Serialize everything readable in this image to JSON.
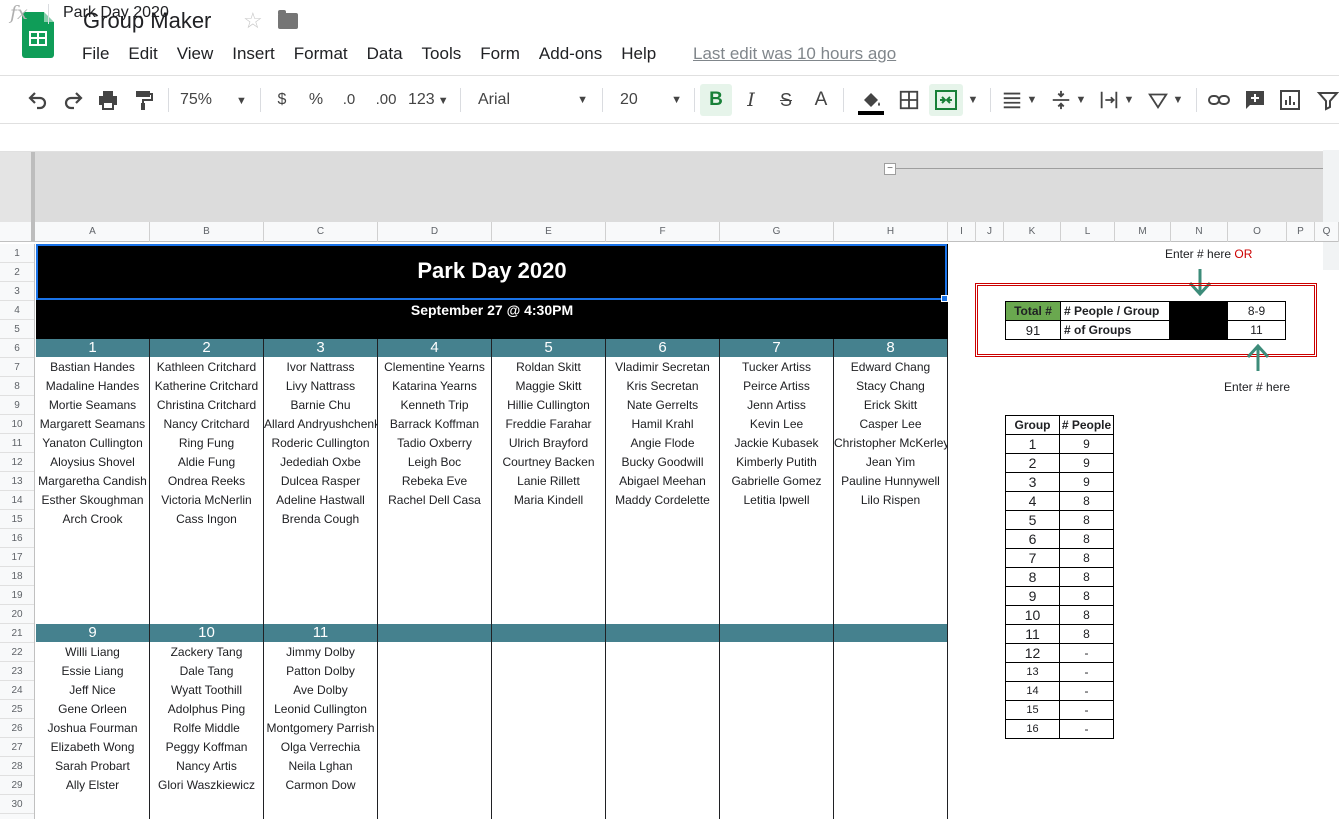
{
  "app": {
    "title": "Group Maker",
    "menu": [
      "File",
      "Edit",
      "View",
      "Insert",
      "Format",
      "Data",
      "Tools",
      "Form",
      "Add-ons",
      "Help"
    ],
    "last_edit": "Last edit was 10 hours ago"
  },
  "toolbar": {
    "zoom": "75%",
    "currency": "$",
    "percent": "%",
    "decrease_decimals": ".0",
    "increase_decimals": ".00",
    "number_format": "123",
    "font": "Arial",
    "font_size": "20",
    "bold": "B",
    "italic": "I",
    "strike": "S",
    "text_color": "A",
    "icons": [
      "undo-icon",
      "redo-icon",
      "print-icon",
      "paint-format-icon",
      "fill-color-icon",
      "borders-icon",
      "merge-cells-icon",
      "align-icon",
      "valign-icon",
      "text-rotate-icon",
      "link-icon",
      "comment-icon",
      "chart-icon",
      "filter-icon"
    ]
  },
  "formula_bar": {
    "fx": "fx",
    "value": "Park Day 2020"
  },
  "columns": [
    "A",
    "B",
    "C",
    "D",
    "E",
    "F",
    "G",
    "H",
    "I",
    "J",
    "K",
    "L",
    "M",
    "N",
    "O",
    "P",
    "Q"
  ],
  "rows": [
    "1",
    "2",
    "3",
    "4",
    "5",
    "6",
    "7",
    "8",
    "9",
    "10",
    "11",
    "12",
    "13",
    "14",
    "15",
    "16",
    "17",
    "18",
    "19",
    "20",
    "21",
    "22",
    "23",
    "24",
    "25",
    "26",
    "27",
    "28",
    "29",
    "30"
  ],
  "sheet": {
    "title": "Park Day 2020",
    "subtitle": "September 27 @ 4:30PM",
    "groups_row1": [
      {
        "num": "1",
        "members": [
          "Bastian Handes",
          "Madaline Handes",
          "Mortie Seamans",
          "Margarett Seamans",
          "Yanaton Cullington",
          "Aloysius Shovel",
          "Margaretha Candish",
          "Esther Skoughman",
          "Arch Crook"
        ]
      },
      {
        "num": "2",
        "members": [
          "Kathleen Critchard",
          "Katherine Critchard",
          "Christina Critchard",
          "Nancy Critchard",
          "Ring Fung",
          "Aldie Fung",
          "Ondrea Reeks",
          "Victoria McNerlin",
          "Cass Ingon"
        ]
      },
      {
        "num": "3",
        "members": [
          "Ivor Nattrass",
          "Livy Nattrass",
          "Barnie Chu",
          "Allard Andryushchenko",
          "Roderic Cullington",
          "Jedediah Oxbe",
          "Dulcea Rasper",
          "Adeline Hastwall",
          "Brenda Cough"
        ]
      },
      {
        "num": "4",
        "members": [
          "Clementine Yearns",
          "Katarina Yearns",
          "Kenneth Trip",
          "Barrack Koffman",
          "Tadio Oxberry",
          "Leigh Boc",
          "Rebeka Eve",
          "Rachel Dell Casa"
        ]
      },
      {
        "num": "5",
        "members": [
          "Roldan Skitt",
          "Maggie Skitt",
          "Hillie Cullington",
          "Freddie Farahar",
          "Ulrich Brayford",
          "Courtney Backen",
          "Lanie Rillett",
          "Maria Kindell"
        ]
      },
      {
        "num": "6",
        "members": [
          "Vladimir Secretan",
          "Kris Secretan",
          "Nate Gerrelts",
          "Hamil Krahl",
          "Angie Flode",
          "Bucky Goodwill",
          "Abigael Meehan",
          "Maddy Cordelette"
        ]
      },
      {
        "num": "7",
        "members": [
          "Tucker Artiss",
          "Peirce Artiss",
          "Jenn Artiss",
          "Kevin Lee",
          "Jackie Kubasek",
          "Kimberly Putith",
          "Gabrielle Gomez",
          "Letitia Ipwell"
        ]
      },
      {
        "num": "8",
        "members": [
          "Edward Chang",
          "Stacy Chang",
          "Erick Skitt",
          "Casper Lee",
          "Christopher McKerley",
          "Jean Yim",
          "Pauline Hunnywell",
          "Lilo Rispen"
        ]
      }
    ],
    "groups_row2": [
      {
        "num": "9",
        "members": [
          "Willi Liang",
          "Essie Liang",
          "Jeff Nice",
          "Gene Orleen",
          "Joshua Fourman",
          "Elizabeth Wong",
          "Sarah Probart",
          "Ally Elster"
        ]
      },
      {
        "num": "10",
        "members": [
          "Zackery Tang",
          "Dale Tang",
          "Wyatt Toothill",
          "Adolphus Ping",
          "Rolfe Middle",
          "Peggy Koffman",
          "Nancy Artis",
          "Glori Waszkiewicz"
        ]
      },
      {
        "num": "11",
        "members": [
          "Jimmy Dolby",
          "Patton Dolby",
          "Ave Dolby",
          "Leonid Cullington",
          "Montgomery Parrish",
          "Olga Verrechia",
          "Neila Lghan",
          "Carmon Dow"
        ]
      },
      {
        "num": "",
        "members": []
      },
      {
        "num": "",
        "members": []
      },
      {
        "num": "",
        "members": []
      },
      {
        "num": "",
        "members": []
      },
      {
        "num": "",
        "members": []
      }
    ]
  },
  "calculator": {
    "note_top": "Enter # here",
    "note_top_or": "OR",
    "note_bottom": "Enter # here",
    "total_label": "Total #",
    "people_label": "# People / Group",
    "people_value": "8-9",
    "total_value": "91",
    "groups_label": "# of Groups",
    "groups_value": "11"
  },
  "group_table": {
    "headers": [
      "Group",
      "# People"
    ],
    "rows": [
      [
        "1",
        "9"
      ],
      [
        "2",
        "9"
      ],
      [
        "3",
        "9"
      ],
      [
        "4",
        "8"
      ],
      [
        "5",
        "8"
      ],
      [
        "6",
        "8"
      ],
      [
        "7",
        "8"
      ],
      [
        "8",
        "8"
      ],
      [
        "9",
        "8"
      ],
      [
        "10",
        "8"
      ],
      [
        "11",
        "8"
      ],
      [
        "12",
        "-"
      ],
      [
        "13",
        "-"
      ],
      [
        "14",
        "-"
      ],
      [
        "15",
        "-"
      ],
      [
        "16",
        "-"
      ]
    ]
  },
  "colors": {
    "banner": "#000000",
    "group_band": "#45818e",
    "total_label_bg": "#6aa84f",
    "accent_green": "#0f9d58",
    "arrow": "#3d8c7a",
    "red_box": "#cc0000"
  }
}
